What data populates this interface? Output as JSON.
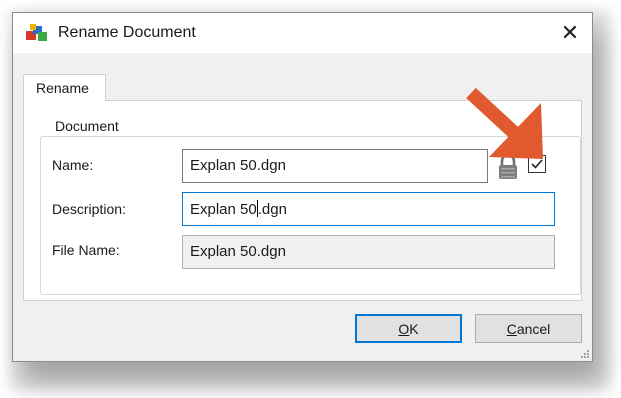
{
  "window": {
    "title": "Rename Document",
    "close_glyph": "✕",
    "icon": "app-icon"
  },
  "tabs": [
    {
      "label": "Rename",
      "active": true
    }
  ],
  "group": {
    "legend": "Document"
  },
  "fields": {
    "name": {
      "label": "Name:",
      "value": "Explan 50.dgn"
    },
    "description": {
      "label": "Description:",
      "value_before_caret": "Explan 50",
      "value_after_caret": ".dgn"
    },
    "file_name": {
      "label": "File Name:",
      "value": "Explan 50.dgn"
    }
  },
  "lock": {
    "icon": "lock-icon",
    "checkbox_checked": true
  },
  "annotation": {
    "icon": "arrow-down-right-icon",
    "color": "#e0592f"
  },
  "buttons": {
    "ok": {
      "mnemonic": "O",
      "rest": "K"
    },
    "cancel": {
      "mnemonic": "C",
      "rest": "ancel"
    }
  },
  "colors": {
    "accent": "#0078d7",
    "dialog_bg": "#f0f0f0"
  }
}
